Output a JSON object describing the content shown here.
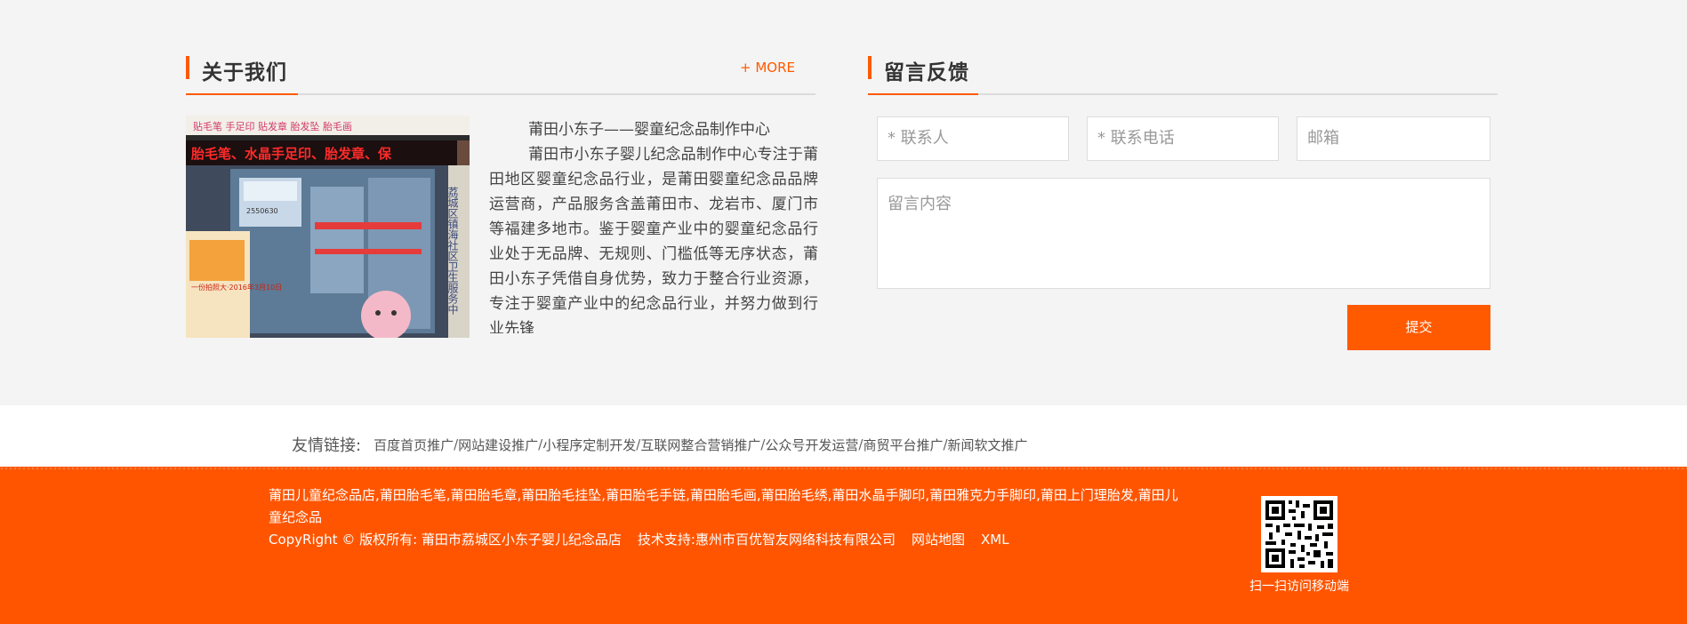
{
  "about": {
    "title": "关于我们",
    "more": "+ MORE",
    "photo_sign_top": "贴毛笔 手足印 贴发章 胎发坠 胎毛画",
    "photo_sign_main": "胎毛笔、水晶手足印、胎发章、保",
    "photo_side_sign": "荔城区镇海社区卫生服务中",
    "photo_shop_label": "2550630",
    "photo_poster": "一份拍照大·2016年3月10日",
    "paragraph_title": "莆田小东子——婴童纪念品制作中心",
    "paragraph_body": "莆田市小东子婴儿纪念品制作中心专注于莆田地区婴童纪念品行业，是莆田婴童纪念品品牌运营商，产品服务含盖莆田市、龙岩市、厦门市等福建多地市。鉴于婴童产业中的婴童纪念品行业处于无品牌、无规则、门槛低等无序状态，莆田小东子凭借自身优势，致力于整合行业资源，专注于婴童产业中的纪念品行业，并努力做到行业先锋"
  },
  "feedback": {
    "title": "留言反馈",
    "contact_placeholder": "* 联系人",
    "phone_placeholder": "* 联系电话",
    "email_placeholder": "邮箱",
    "message_placeholder": "留言内容",
    "submit_label": "提交"
  },
  "friend_links": {
    "label": "友情链接:",
    "separator": "/",
    "items": [
      "百度首页推广",
      "网站建设推广",
      "小程序定制开发",
      "互联网整合营销推广",
      "公众号开发运营",
      "商贸平台推广",
      "新闻软文推广"
    ]
  },
  "footer": {
    "keywords": "莆田儿童纪念品店,莆田胎毛笔,莆田胎毛章,莆田胎毛挂坠,莆田胎毛手链,莆田胎毛画,莆田胎毛绣,莆田水晶手脚印,莆田雅克力手脚印,莆田上门理胎发,莆田儿童纪念品",
    "copyright": "CopyRight © 版权所有: 莆田市荔城区小东子婴儿纪念品店",
    "tech_support": "技术支持:惠州市百优智友网络科技有限公司",
    "sitemap": "网站地图",
    "xml": "XML",
    "qr_caption": "扫一扫访问移动端"
  },
  "colors": {
    "accent": "#ff5a00",
    "footer_bg": "#ff5500",
    "section_bg": "#f4f4f4"
  },
  "icons": [
    "qr-code-icon"
  ]
}
